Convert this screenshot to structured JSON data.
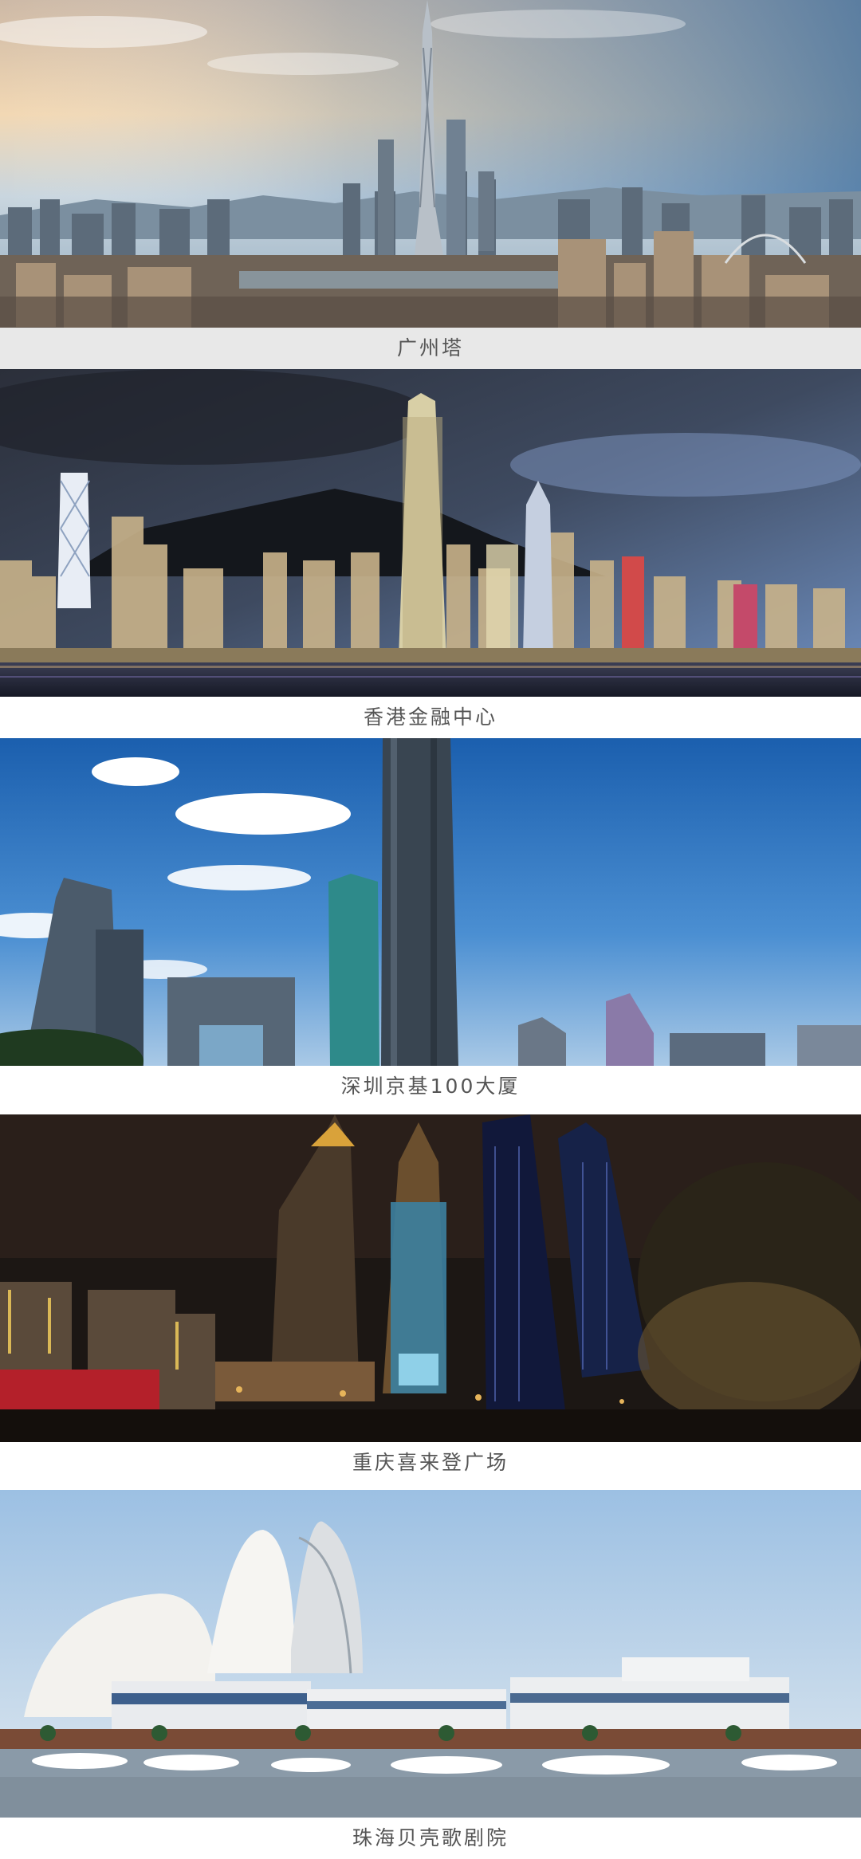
{
  "gallery": {
    "items": [
      {
        "caption": "广州塔"
      },
      {
        "caption": "香港金融中心"
      },
      {
        "caption": "深圳京基100大厦"
      },
      {
        "caption": "重庆喜来登广场"
      },
      {
        "caption": "珠海贝壳歌剧院"
      }
    ]
  }
}
